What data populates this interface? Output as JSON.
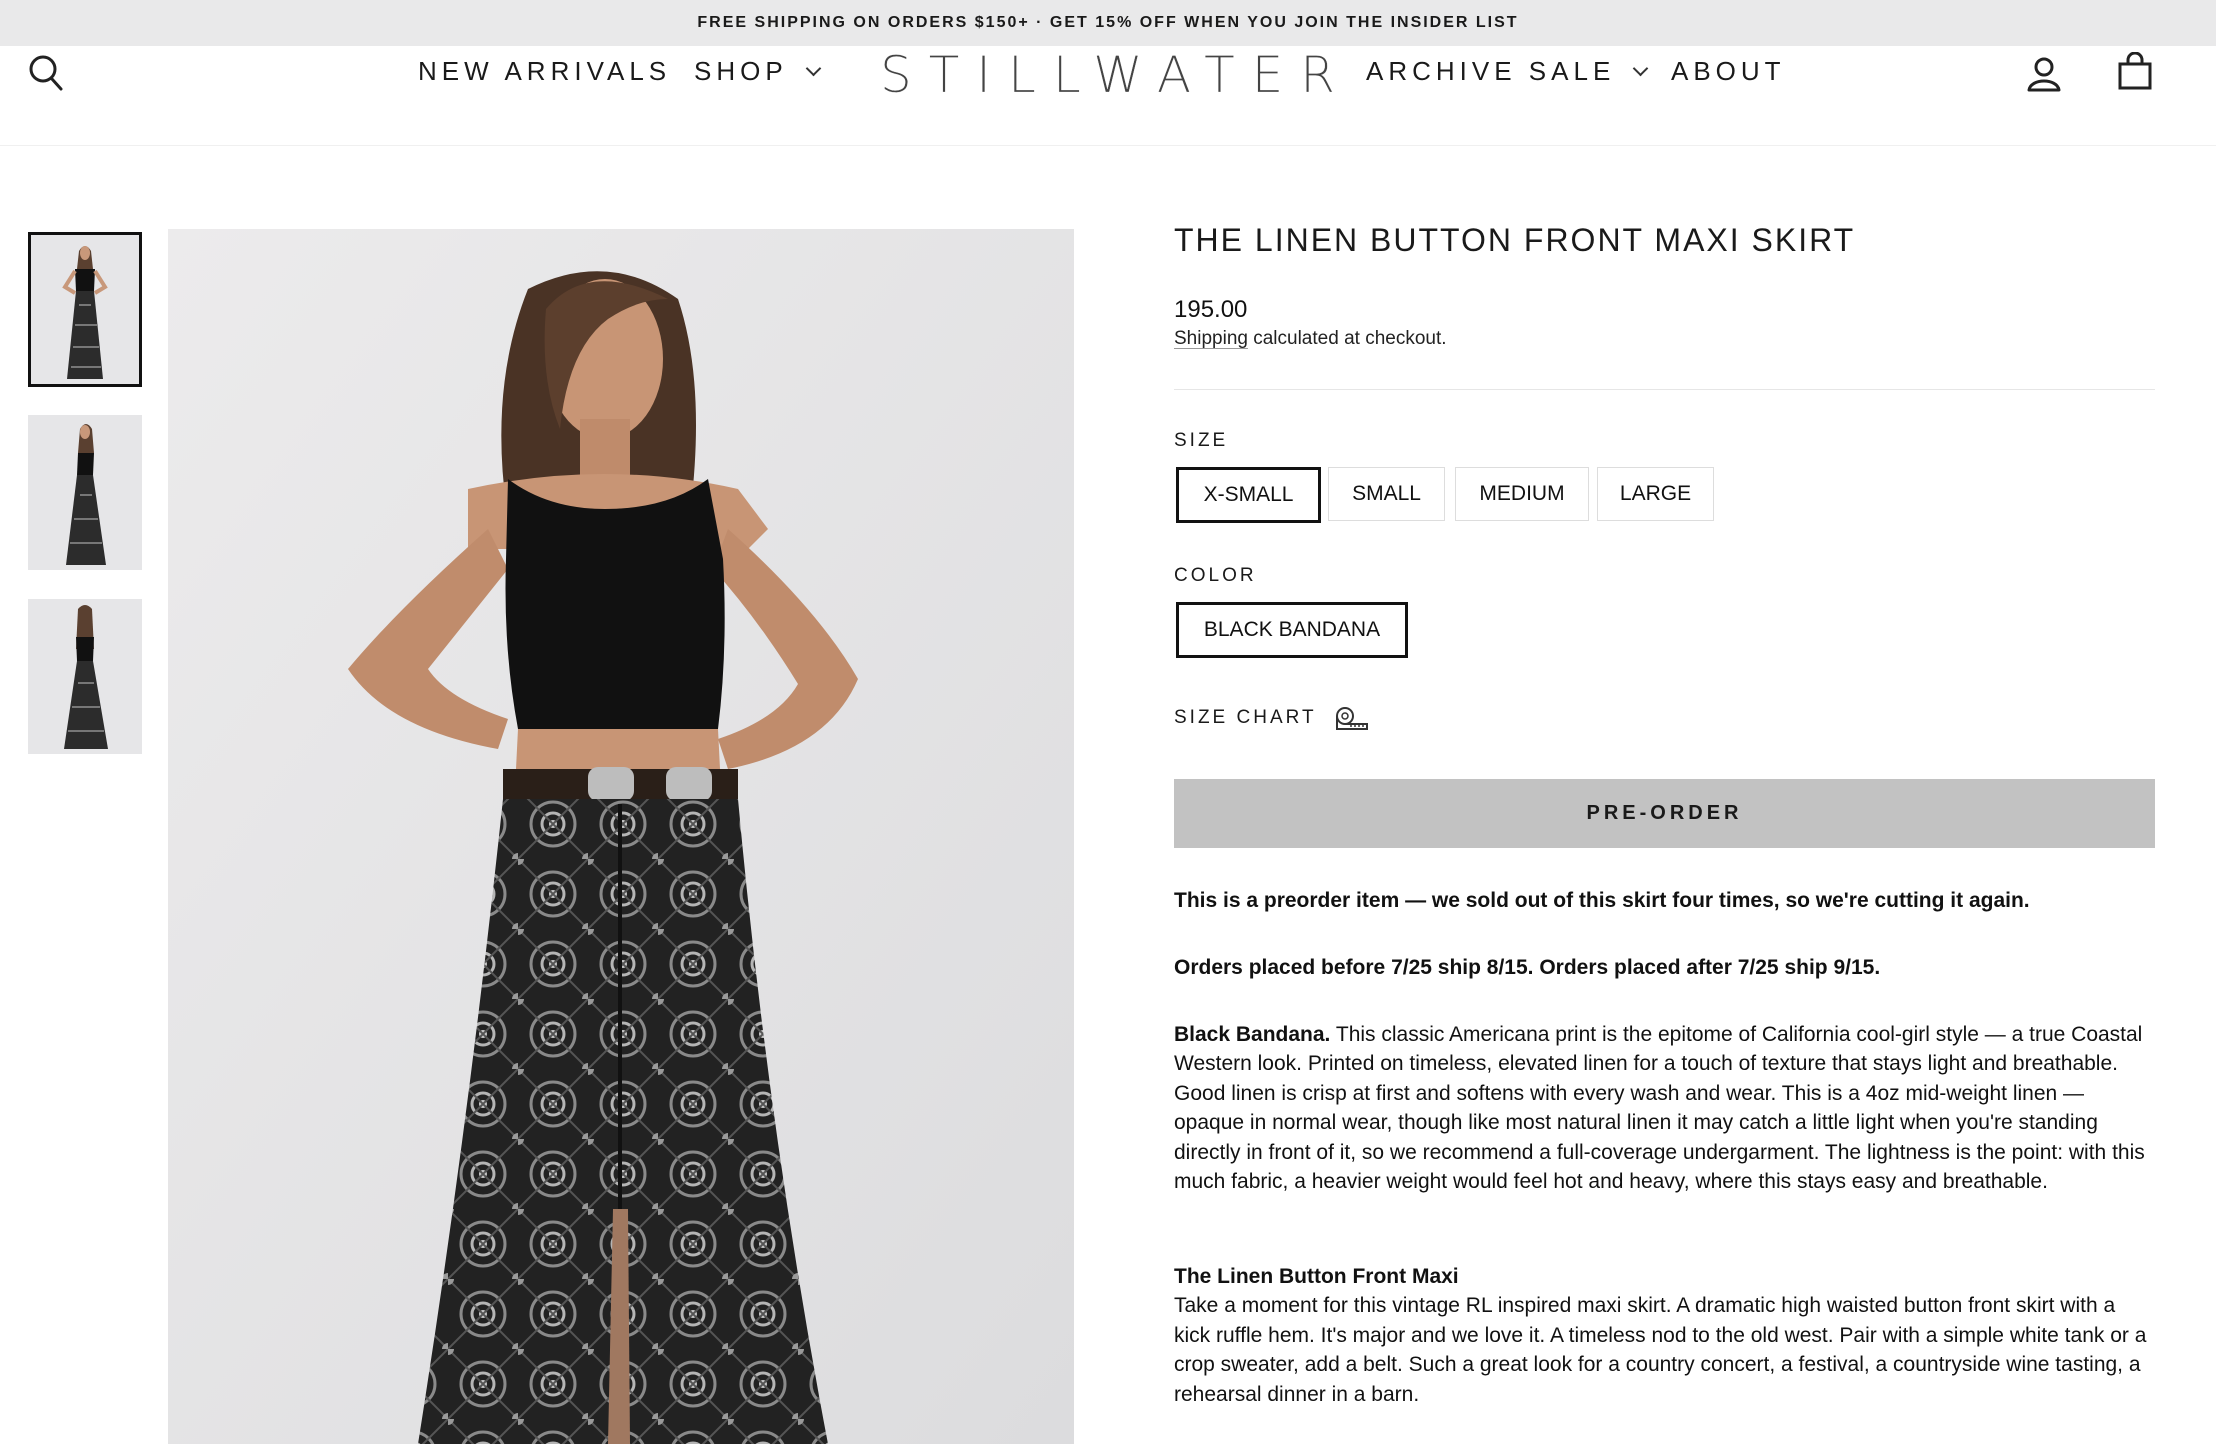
{
  "announcement": "FREE SHIPPING ON ORDERS $150+ · GET 15% OFF WHEN YOU JOIN THE INSIDER LIST",
  "header": {
    "logo": "STILLWATER",
    "nav": {
      "new_arrivals": "NEW ARRIVALS",
      "shop": "SHOP",
      "archive_sale": "ARCHIVE SALE",
      "about": "ABOUT"
    },
    "icons": [
      "search-icon",
      "account-icon",
      "cart-icon"
    ]
  },
  "gallery": {
    "thumbnails": [
      "front view",
      "side view",
      "back view"
    ],
    "active_thumbnail": 0
  },
  "product": {
    "title": "THE LINEN BUTTON FRONT MAXI SKIRT",
    "price": "195.00",
    "shipping_link": "Shipping",
    "shipping_note": " calculated at checkout.",
    "size_label": "SIZE",
    "sizes": [
      "X-SMALL",
      "SMALL",
      "MEDIUM",
      "LARGE"
    ],
    "selected_size": "X-SMALL",
    "color_label": "COLOR",
    "colors": [
      "BLACK BANDANA"
    ],
    "selected_color": "BLACK BANDANA",
    "size_chart": "SIZE CHART",
    "preorder_button": "PRE-ORDER"
  },
  "description": {
    "preorder_note": "This is a preorder item — we sold out of this skirt four times, so we're cutting it again.",
    "ship_dates": "Orders placed before 7/25 ship 8/15. Orders placed after 7/25 ship 9/15.",
    "print_heading": "Black Bandana.",
    "print_text": " This classic Americana print is the epitome of California cool-girl style — a true Coastal Western look. Printed on timeless, elevated linen for a touch of texture that stays light and breathable. Good linen is crisp at first and softens with every wash and wear. This is a 4oz mid-weight linen — opaque in normal wear, though like most natural linen it may catch a little light when you're standing directly in front of it, so we recommend a full-coverage undergarment. The lightness is the point: with this much fabric, a heavier weight would feel hot and heavy, where this stays easy and breathable.",
    "style_heading": "The Linen Button Front Maxi",
    "style_text": "Take a moment for this vintage RL inspired maxi skirt. A dramatic high waisted button front skirt with a kick ruffle hem. It's major and we love it. A timeless nod to the old west. Pair with a simple white tank or a crop sweater, add a belt. Such a great look for a country concert, a festival, a countryside wine tasting, a rehearsal dinner in a barn."
  },
  "colors": {
    "announcement_bg": "#e9e9ea",
    "preorder_bg": "#c2c2c2",
    "text": "#111111"
  }
}
